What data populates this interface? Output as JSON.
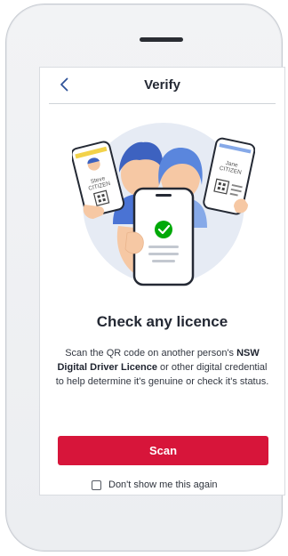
{
  "header": {
    "title": "Verify",
    "back_icon": "chevron-left-icon"
  },
  "illustration": {
    "card_left": {
      "line1": "Steve",
      "line2": "CITIZEN"
    },
    "card_right": {
      "line1": "Jane",
      "line2": "CITIZEN"
    },
    "status_icon": "check-circle-icon"
  },
  "content": {
    "heading": "Check any licence",
    "body_before": "Scan the QR code on another person's ",
    "body_bold": "NSW Digital Driver Licence",
    "body_after": " or other digital credential to help determine it's genuine or check it's status."
  },
  "actions": {
    "scan_label": "Scan",
    "dont_show_label": "Don't show me this again",
    "dont_show_checked": false
  },
  "colors": {
    "accent": "#d7153a",
    "navy": "#2e5299",
    "check": "#00a908"
  }
}
